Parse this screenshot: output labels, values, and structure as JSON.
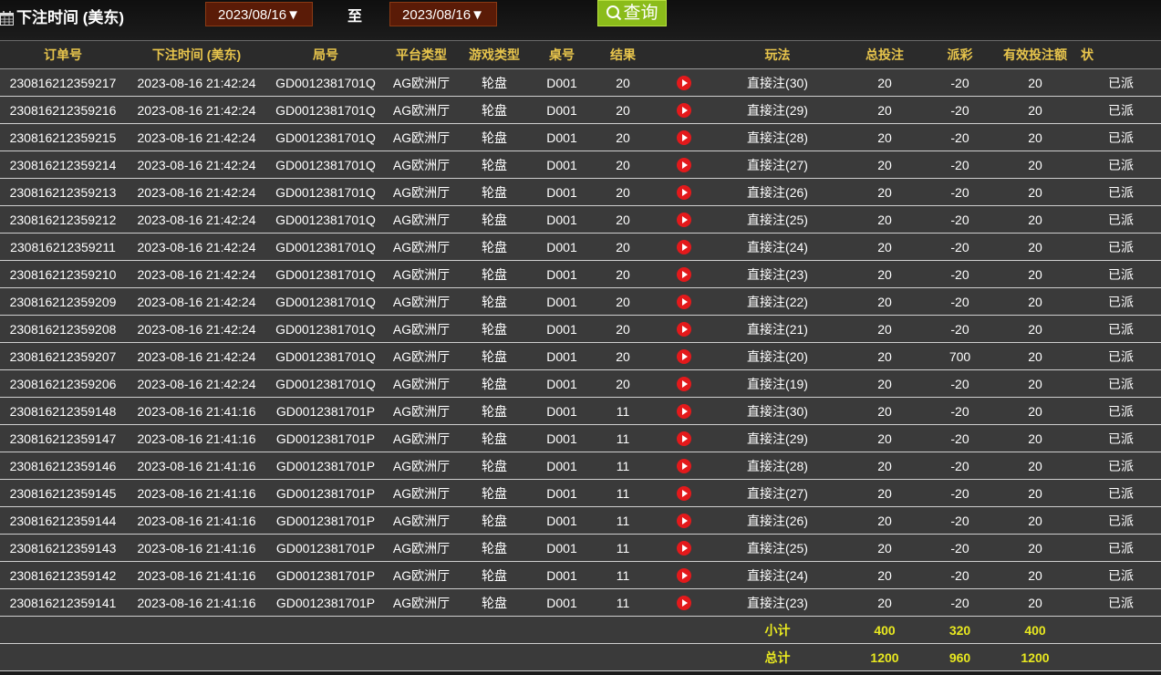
{
  "filter": {
    "label": "下注时间 (美东)",
    "from_date": "2023/08/16▼",
    "to_label": "至",
    "to_date": "2023/08/16▼",
    "query_label": "查询"
  },
  "columns": [
    "订单号",
    "下注时间 (美东)",
    "局号",
    "平台类型",
    "游戏类型",
    "桌号",
    "结果",
    "",
    "玩法",
    "总投注",
    "派彩",
    "有效投注额",
    "状"
  ],
  "rows": [
    [
      "230816212359217",
      "2023-08-16 21:42:24",
      "GD0012381701Q",
      "AG欧洲厅",
      "轮盘",
      "D001",
      "20",
      "直接注(30)",
      "20",
      "-20",
      "20",
      "已派"
    ],
    [
      "230816212359216",
      "2023-08-16 21:42:24",
      "GD0012381701Q",
      "AG欧洲厅",
      "轮盘",
      "D001",
      "20",
      "直接注(29)",
      "20",
      "-20",
      "20",
      "已派"
    ],
    [
      "230816212359215",
      "2023-08-16 21:42:24",
      "GD0012381701Q",
      "AG欧洲厅",
      "轮盘",
      "D001",
      "20",
      "直接注(28)",
      "20",
      "-20",
      "20",
      "已派"
    ],
    [
      "230816212359214",
      "2023-08-16 21:42:24",
      "GD0012381701Q",
      "AG欧洲厅",
      "轮盘",
      "D001",
      "20",
      "直接注(27)",
      "20",
      "-20",
      "20",
      "已派"
    ],
    [
      "230816212359213",
      "2023-08-16 21:42:24",
      "GD0012381701Q",
      "AG欧洲厅",
      "轮盘",
      "D001",
      "20",
      "直接注(26)",
      "20",
      "-20",
      "20",
      "已派"
    ],
    [
      "230816212359212",
      "2023-08-16 21:42:24",
      "GD0012381701Q",
      "AG欧洲厅",
      "轮盘",
      "D001",
      "20",
      "直接注(25)",
      "20",
      "-20",
      "20",
      "已派"
    ],
    [
      "230816212359211",
      "2023-08-16 21:42:24",
      "GD0012381701Q",
      "AG欧洲厅",
      "轮盘",
      "D001",
      "20",
      "直接注(24)",
      "20",
      "-20",
      "20",
      "已派"
    ],
    [
      "230816212359210",
      "2023-08-16 21:42:24",
      "GD0012381701Q",
      "AG欧洲厅",
      "轮盘",
      "D001",
      "20",
      "直接注(23)",
      "20",
      "-20",
      "20",
      "已派"
    ],
    [
      "230816212359209",
      "2023-08-16 21:42:24",
      "GD0012381701Q",
      "AG欧洲厅",
      "轮盘",
      "D001",
      "20",
      "直接注(22)",
      "20",
      "-20",
      "20",
      "已派"
    ],
    [
      "230816212359208",
      "2023-08-16 21:42:24",
      "GD0012381701Q",
      "AG欧洲厅",
      "轮盘",
      "D001",
      "20",
      "直接注(21)",
      "20",
      "-20",
      "20",
      "已派"
    ],
    [
      "230816212359207",
      "2023-08-16 21:42:24",
      "GD0012381701Q",
      "AG欧洲厅",
      "轮盘",
      "D001",
      "20",
      "直接注(20)",
      "20",
      "700",
      "20",
      "已派"
    ],
    [
      "230816212359206",
      "2023-08-16 21:42:24",
      "GD0012381701Q",
      "AG欧洲厅",
      "轮盘",
      "D001",
      "20",
      "直接注(19)",
      "20",
      "-20",
      "20",
      "已派"
    ],
    [
      "230816212359148",
      "2023-08-16 21:41:16",
      "GD0012381701P",
      "AG欧洲厅",
      "轮盘",
      "D001",
      "11",
      "直接注(30)",
      "20",
      "-20",
      "20",
      "已派"
    ],
    [
      "230816212359147",
      "2023-08-16 21:41:16",
      "GD0012381701P",
      "AG欧洲厅",
      "轮盘",
      "D001",
      "11",
      "直接注(29)",
      "20",
      "-20",
      "20",
      "已派"
    ],
    [
      "230816212359146",
      "2023-08-16 21:41:16",
      "GD0012381701P",
      "AG欧洲厅",
      "轮盘",
      "D001",
      "11",
      "直接注(28)",
      "20",
      "-20",
      "20",
      "已派"
    ],
    [
      "230816212359145",
      "2023-08-16 21:41:16",
      "GD0012381701P",
      "AG欧洲厅",
      "轮盘",
      "D001",
      "11",
      "直接注(27)",
      "20",
      "-20",
      "20",
      "已派"
    ],
    [
      "230816212359144",
      "2023-08-16 21:41:16",
      "GD0012381701P",
      "AG欧洲厅",
      "轮盘",
      "D001",
      "11",
      "直接注(26)",
      "20",
      "-20",
      "20",
      "已派"
    ],
    [
      "230816212359143",
      "2023-08-16 21:41:16",
      "GD0012381701P",
      "AG欧洲厅",
      "轮盘",
      "D001",
      "11",
      "直接注(25)",
      "20",
      "-20",
      "20",
      "已派"
    ],
    [
      "230816212359142",
      "2023-08-16 21:41:16",
      "GD0012381701P",
      "AG欧洲厅",
      "轮盘",
      "D001",
      "11",
      "直接注(24)",
      "20",
      "-20",
      "20",
      "已派"
    ],
    [
      "230816212359141",
      "2023-08-16 21:41:16",
      "GD0012381701P",
      "AG欧洲厅",
      "轮盘",
      "D001",
      "11",
      "直接注(23)",
      "20",
      "-20",
      "20",
      "已派"
    ]
  ],
  "subtotal": {
    "label": "小计",
    "bet": "400",
    "payout": "320",
    "valid": "400"
  },
  "total": {
    "label": "总计",
    "bet": "1200",
    "payout": "960",
    "valid": "1200"
  },
  "colors": {
    "header_text": "#e8c54c",
    "negative": "#33d61a",
    "positive": "#c01818",
    "summary": "#e8e820",
    "play_button": "#e3191b"
  },
  "icons": {
    "calendar": "calendar-icon",
    "query": "search-icon",
    "result_play": "play-icon"
  }
}
